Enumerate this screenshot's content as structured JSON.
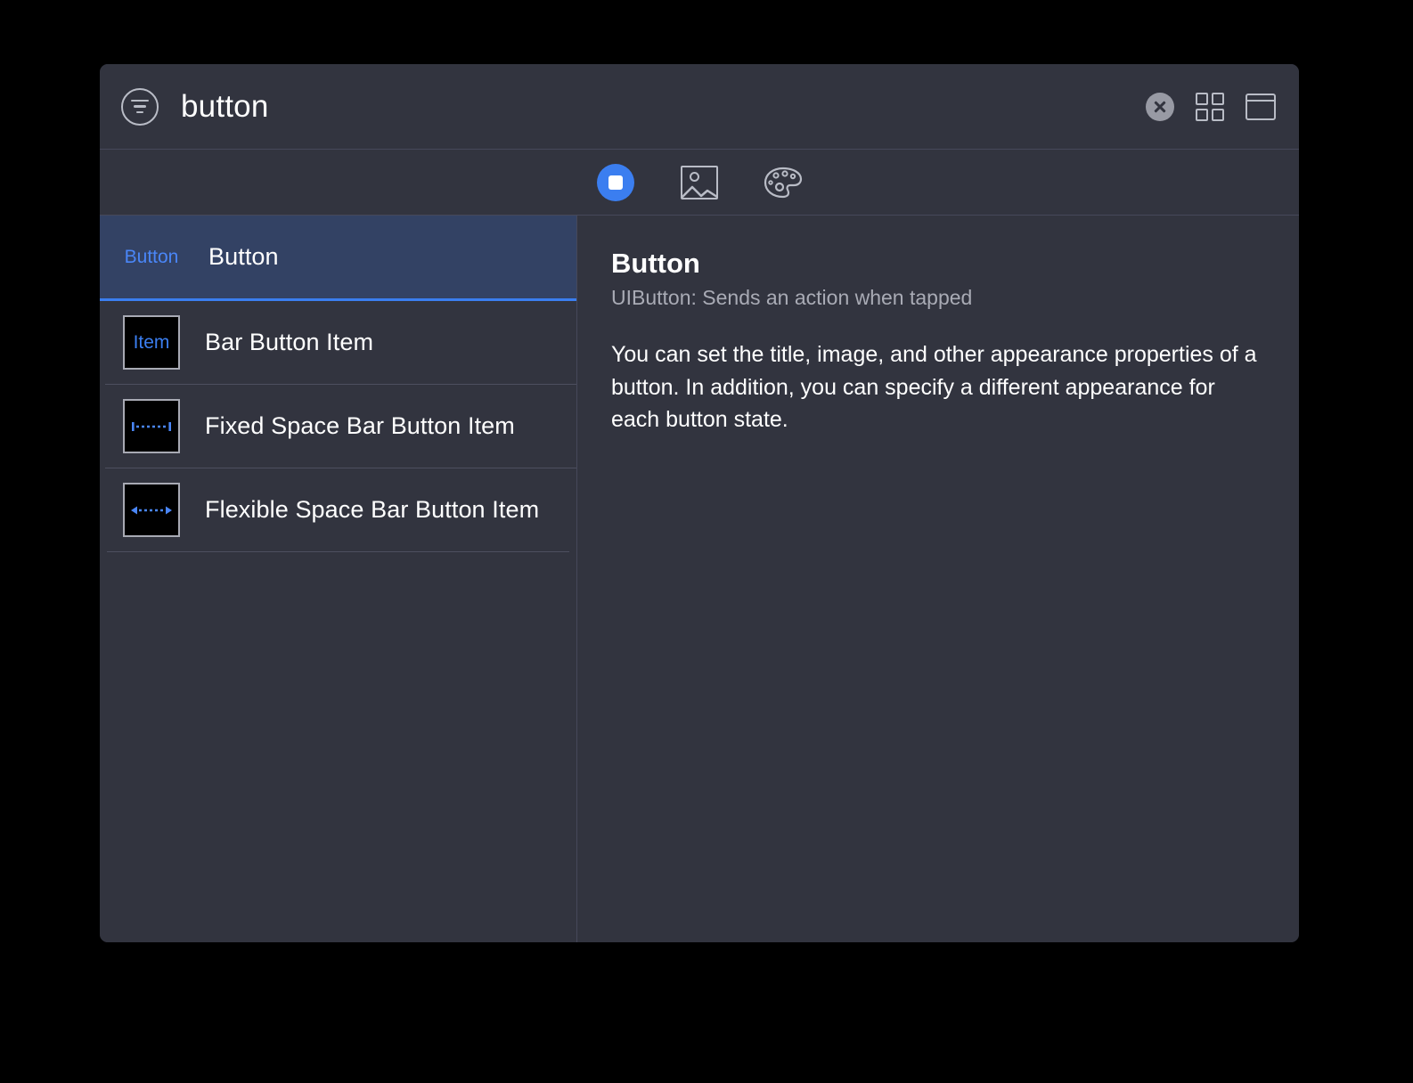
{
  "window": {
    "title": "button",
    "filter_icon": "filter-icon"
  },
  "titlebar_actions": [
    {
      "name": "clear-search-icon",
      "label": "Clear"
    },
    {
      "name": "grid-view-icon",
      "label": "Grid View"
    },
    {
      "name": "panel-view-icon",
      "label": "Panel View"
    }
  ],
  "tabs": [
    {
      "name": "tab-objects",
      "icon": "object-square-icon",
      "active": true
    },
    {
      "name": "tab-media",
      "icon": "image-icon",
      "active": false
    },
    {
      "name": "tab-colors",
      "icon": "color-palette-icon",
      "active": false
    }
  ],
  "list": {
    "items": [
      {
        "label": "Button",
        "thumb_text": "Button",
        "thumb_type": "text",
        "selected": true
      },
      {
        "label": "Bar Button Item",
        "thumb_text": "Item",
        "thumb_type": "boxed-text",
        "selected": false
      },
      {
        "label": "Fixed Space Bar Button Item",
        "thumb_text": "",
        "thumb_type": "fixed-space",
        "selected": false
      },
      {
        "label": "Flexible Space Bar Button Item",
        "thumb_text": "",
        "thumb_type": "flexible-space",
        "selected": false
      }
    ]
  },
  "detail": {
    "title": "Button",
    "subtitle": "UIButton: Sends an action when tapped",
    "body": "You can set the title, image, and other appearance properties of a button. In addition, you can specify a different appearance for each button state."
  },
  "colors": {
    "accent": "#3b7ef0",
    "panel_bg": "#32343f",
    "selected_row": "#334264",
    "border": "#46485a",
    "text": "#ffffff",
    "muted_text": "#a9abb5"
  }
}
